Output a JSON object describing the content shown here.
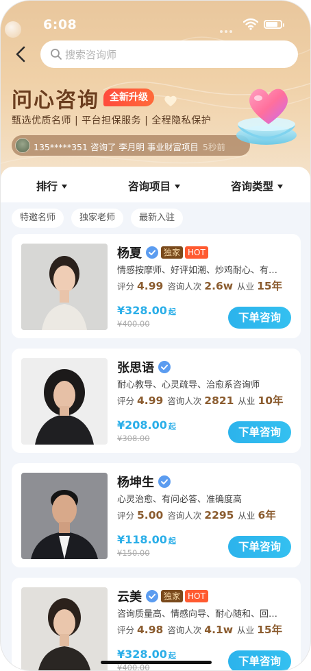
{
  "status_bar": {
    "time": "6:08"
  },
  "search": {
    "placeholder": "搜索咨询师"
  },
  "hero": {
    "title": "问心咨询",
    "upgrade_badge": "全新升级",
    "tagline": "甄选优质名师 | 平台担保服务 | 全程隐私保护",
    "notice_text": "135*****351 咨询了 李月明 事业财富项目",
    "notice_time": "5秒前"
  },
  "filters": [
    {
      "label": "排行"
    },
    {
      "label": "咨询项目"
    },
    {
      "label": "咨询类型"
    }
  ],
  "chips": [
    {
      "label": "特邀名师"
    },
    {
      "label": "独家老师"
    },
    {
      "label": "最新入驻"
    }
  ],
  "labels": {
    "rating": "评分",
    "consults": "咨询人次",
    "experience": "从业",
    "order_button": "下单咨询",
    "exclusive": "独家",
    "hot": "HOT",
    "price_suffix": "起"
  },
  "counselors": [
    {
      "name": "杨夏",
      "exclusive": true,
      "hot": true,
      "desc": "情感按摩师、好评如潮、炒鸡耐心、有…",
      "rating": "4.99",
      "consults": "2.6w",
      "years": "15年",
      "price": "¥328.00",
      "original_price": "¥400.00"
    },
    {
      "name": "张思语",
      "exclusive": false,
      "hot": false,
      "desc": "耐心教导、心灵疏导、治愈系咨询师",
      "rating": "4.99",
      "consults": "2821",
      "years": "10年",
      "price": "¥208.00",
      "original_price": "¥308.00"
    },
    {
      "name": "杨坤生",
      "exclusive": false,
      "hot": false,
      "desc": "心灵治愈、有问必答、准确度高",
      "rating": "5.00",
      "consults": "2295",
      "years": "6年",
      "price": "¥118.00",
      "original_price": "¥150.00"
    },
    {
      "name": "云美",
      "exclusive": true,
      "hot": true,
      "desc": "咨询质量高、情感向导、耐心随和、回…",
      "rating": "4.98",
      "consults": "4.1w",
      "years": "15年",
      "price": "¥328.00",
      "original_price": "¥400.00"
    }
  ],
  "colors": {
    "hero_top": "#e9c79d",
    "title": "#6b3e1f",
    "accent_blue": "#2aaee8",
    "upgrade_red": "#ff4b3c",
    "hot_orange": "#ff5a30",
    "exclusive_brown": "#7a4a1c",
    "stat_value": "#8a5b2e"
  }
}
